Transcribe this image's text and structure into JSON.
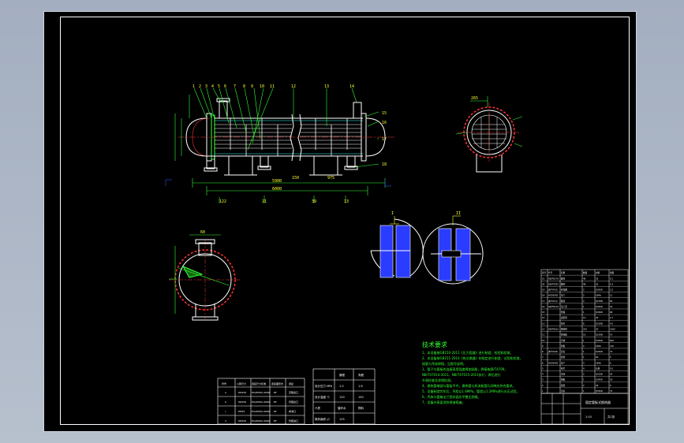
{
  "colors": {
    "line_white": "#ffffff",
    "line_green": "#33ff33",
    "line_cyan": "#33ffff",
    "line_blue": "#3050ff",
    "line_yellow": "#ffff33",
    "line_red": "#ff3333",
    "hatch_blue": "#2a3cff"
  },
  "main_view": {
    "balloons": [
      "1",
      "2",
      "3",
      "4",
      "5",
      "6",
      "7",
      "8",
      "9",
      "10",
      "11",
      "12",
      "13",
      "14"
    ],
    "right_callouts": [
      "15",
      "16",
      "17",
      "18"
    ],
    "dimensions": {
      "overall": "5900",
      "inner": "6000",
      "left_support": "150",
      "right_support": "975",
      "left_bottom": "122",
      "mid_bottom": "21",
      "right_bottom": "39",
      "far_right_bottom": "13"
    }
  },
  "end_view_right": {
    "top_dim": "265"
  },
  "section_view": {
    "top_dim": "60"
  },
  "detail_left": {
    "label": "I"
  },
  "detail_right": {
    "label": "II"
  },
  "tech_requirements": {
    "title": "技术要求",
    "lines": [
      "1、本设备按GB150-2011《压力容器》进行制造、检验和验收。",
      "2、本设备按GB151-2014《热交换器》的规定进行制造、试验和验收。",
      "   接管与壳体焊接，见图号说明。",
      "3、管子与管板的连接采用强度焊加贴胀，焊接按JB/T4709，",
      "   NB/T47014-2011、NB/T47015-2011执行，焊后进行",
      "   外观检查及渗透检测。",
      "4、换热管端部与管板平齐，换热管与折流板管孔间隙应符合要求。",
      "5、设备制造完毕后，壳程以1.6MPa，管程以1.2MPa进行水压试验。",
      "6、壳体与管箱法兰密封面应平整无划痕。",
      "7、设备外表面涂防锈漆两遍。"
    ]
  },
  "nozzle_table": {
    "rows": [
      [
        "符号",
        "公称尺寸",
        "连接尺寸标准",
        "连接面形式",
        "用途"
      ],
      [
        "a",
        "DN150",
        "HG20592-2009",
        "RF",
        "壳程出口"
      ],
      [
        "b",
        "DN150",
        "HG20592-2009",
        "RF",
        "管程出口"
      ],
      [
        "c",
        "DN25",
        "HG20592-2009",
        "RF",
        "排净口"
      ],
      [
        "d",
        "DN150",
        "HG20592-2009",
        "RF",
        "管程进口"
      ]
    ]
  },
  "design_table": {
    "rows": [
      [
        "",
        "管程",
        "壳程"
      ],
      [
        "设计压力 MPa",
        "1.0",
        "1.6"
      ],
      [
        "设计温度 ℃",
        "120",
        "150"
      ],
      [
        "介质",
        "循环水",
        "物料"
      ],
      [
        "换热面积 ㎡",
        "125"
      ]
    ]
  },
  "parts_list": {
    "rows": [
      [
        "序号",
        "代号",
        "名称",
        "数量",
        "材料",
        "重量"
      ],
      [
        "21",
        "GB/T6170",
        "螺母",
        "48",
        "35",
        "0.1"
      ],
      [
        "20",
        "GB/T5782",
        "螺栓",
        "48",
        "35",
        "0.3"
      ],
      [
        "19",
        "JB/T4736",
        "补强圈",
        "2",
        "Q345R",
        "3.2"
      ],
      [
        "18",
        "HG20592",
        "法兰",
        "2",
        "16Mn",
        "12"
      ],
      [
        "17",
        "JB/T4712",
        "鞍座",
        "2",
        "Q235B",
        "85"
      ],
      [
        "16",
        "GB/T9119",
        "法兰盖",
        "1",
        "Q345R",
        "18"
      ],
      [
        "15",
        "",
        "管箱",
        "1",
        "Q345R",
        "96"
      ],
      [
        "14",
        "",
        "定距管",
        "12",
        "20",
        "2.1"
      ],
      [
        "13",
        "",
        "拉杆",
        "6",
        "Q235B",
        "4.5"
      ],
      [
        "12",
        "GB/T8163",
        "换热管",
        "232",
        "20",
        "1560"
      ],
      [
        "11",
        "",
        "折流板",
        "10",
        "Q235B",
        "14"
      ],
      [
        "10",
        "",
        "壳体",
        "1",
        "Q345R",
        "620"
      ],
      [
        "9",
        "",
        "管板",
        "2",
        "16Mn",
        "140"
      ],
      [
        "8",
        "JB/T4746",
        "封头",
        "1",
        "Q345R",
        "72"
      ],
      [
        "7",
        "",
        "接管",
        "1",
        "20",
        "5"
      ],
      [
        "6",
        "HG20592",
        "法兰",
        "4",
        "16Mn",
        "9"
      ],
      [
        "5",
        "",
        "垫片",
        "4",
        "石棉",
        "0.5"
      ],
      [
        "4",
        "",
        "支座",
        "2",
        "Q235B",
        "30"
      ],
      [
        "3",
        "",
        "隔板",
        "1",
        "Q345R",
        "18"
      ],
      [
        "2",
        "",
        "接管",
        "2",
        "20",
        "6"
      ],
      [
        "1",
        "",
        "封头",
        "1",
        "Q345R",
        "72"
      ]
    ]
  },
  "title_block": {
    "name": "固定管板式换热器",
    "scale": "1:10",
    "sheet": "共1张"
  }
}
